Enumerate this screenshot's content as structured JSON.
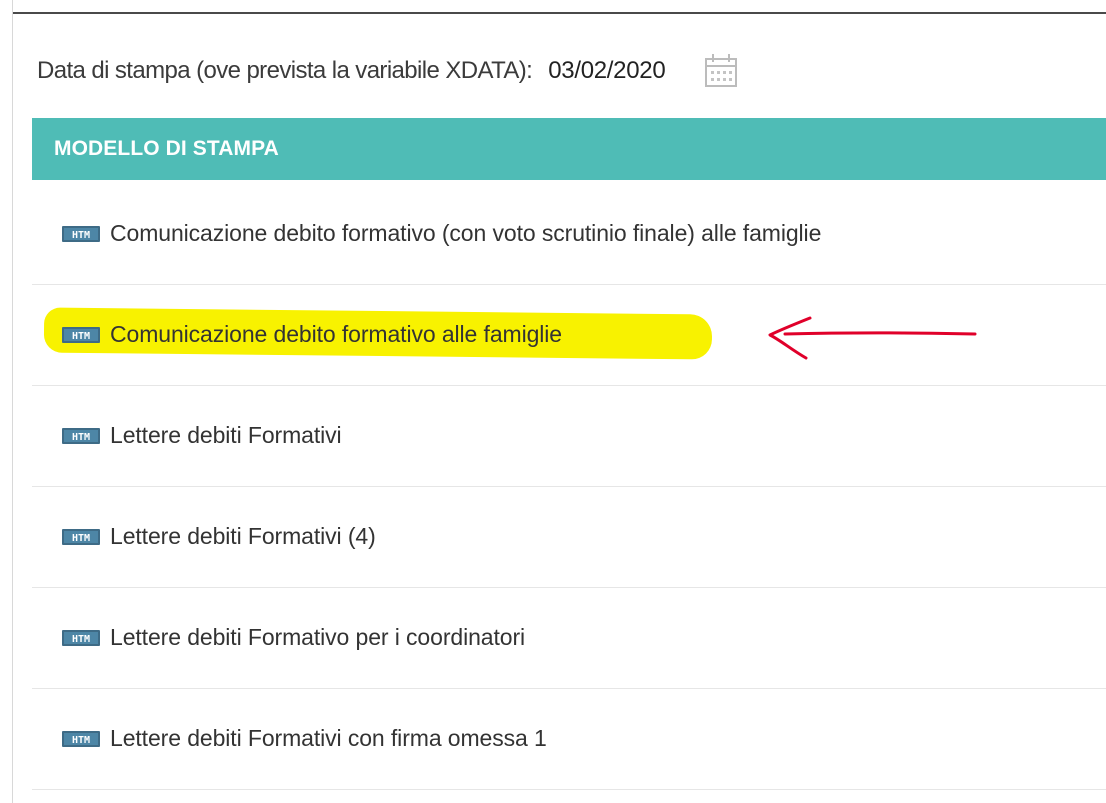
{
  "print_date": {
    "label": "Data di stampa (ove prevista la variabile XDATA):",
    "value": "03/02/2020",
    "icon": "calendar-icon"
  },
  "table": {
    "header": "MODELLO DI STAMPA",
    "rows": [
      {
        "icon": "htm-file-icon",
        "label": "Comunicazione debito formativo (con voto scrutinio finale) alle famiglie"
      },
      {
        "icon": "htm-file-icon",
        "label": "Comunicazione debito formativo alle famiglie",
        "highlighted": true
      },
      {
        "icon": "htm-file-icon",
        "label": "Lettere debiti Formativi"
      },
      {
        "icon": "htm-file-icon",
        "label": "Lettere debiti Formativi (4)"
      },
      {
        "icon": "htm-file-icon",
        "label": "Lettere debiti Formativo per i coordinatori"
      },
      {
        "icon": "htm-file-icon",
        "label": "Lettere debiti Formativi con firma omessa 1"
      }
    ]
  },
  "annotation": {
    "highlight_color": "#f8f200",
    "arrow_color": "#e0002a"
  },
  "colors": {
    "header_bg": "#4fbcb6"
  }
}
